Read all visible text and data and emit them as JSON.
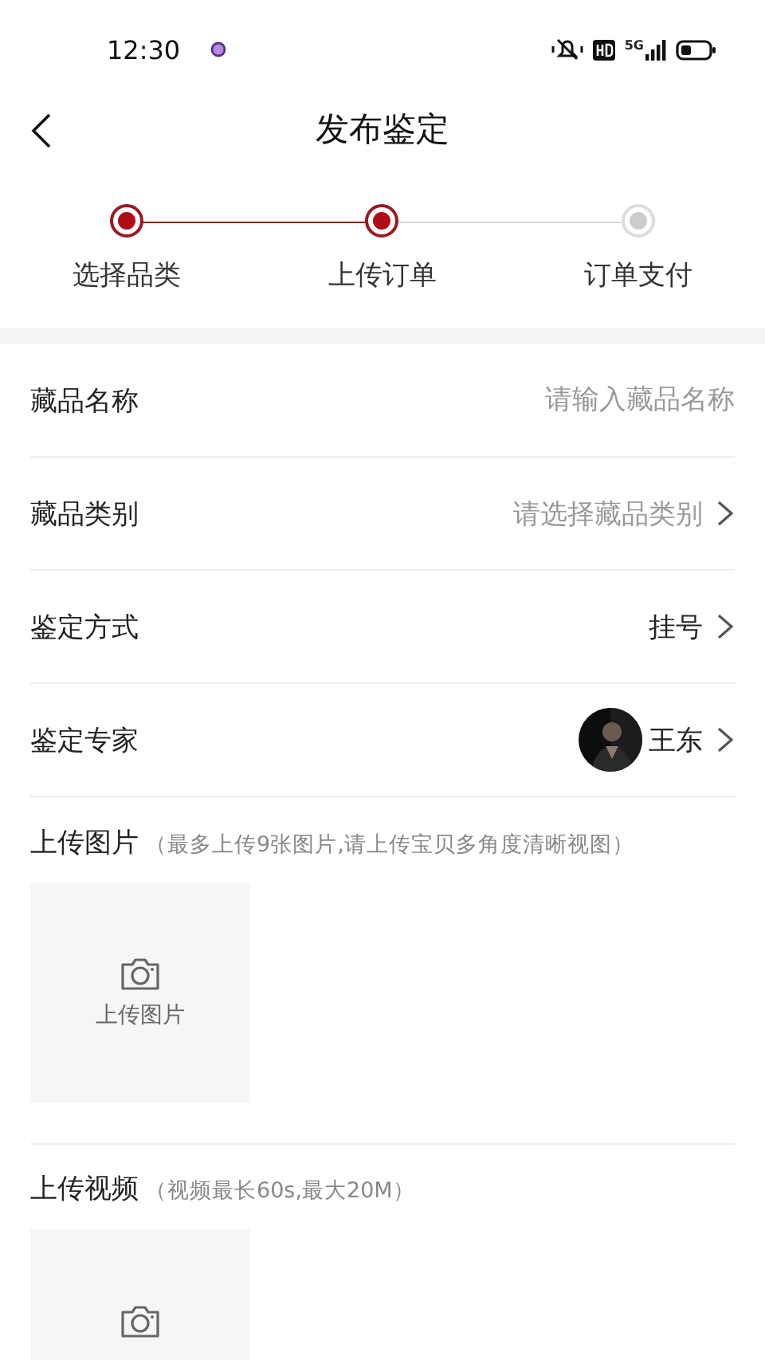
{
  "status_bar": {
    "time": "12:30",
    "network": "5G"
  },
  "header": {
    "title": "发布鉴定"
  },
  "steps": [
    {
      "label": "选择品类",
      "done": true
    },
    {
      "label": "上传订单",
      "done": true
    },
    {
      "label": "订单支付",
      "done": false
    }
  ],
  "form": [
    {
      "kind": "input",
      "label": "藏品名称",
      "placeholder": "请输入藏品名称"
    },
    {
      "kind": "select",
      "label": "藏品类别",
      "placeholder": "请选择藏品类别"
    },
    {
      "kind": "select",
      "label": "鉴定方式",
      "value": "挂号"
    },
    {
      "kind": "expert",
      "label": "鉴定专家",
      "value": "王东"
    }
  ],
  "uploads": [
    {
      "title": "上传图片",
      "hint": "（最多上传9张图片,请上传宝贝多角度清晰视图）",
      "tile_label": "上传图片"
    },
    {
      "title": "上传视频",
      "hint": "（视频最长60s,最大20M）"
    }
  ]
}
